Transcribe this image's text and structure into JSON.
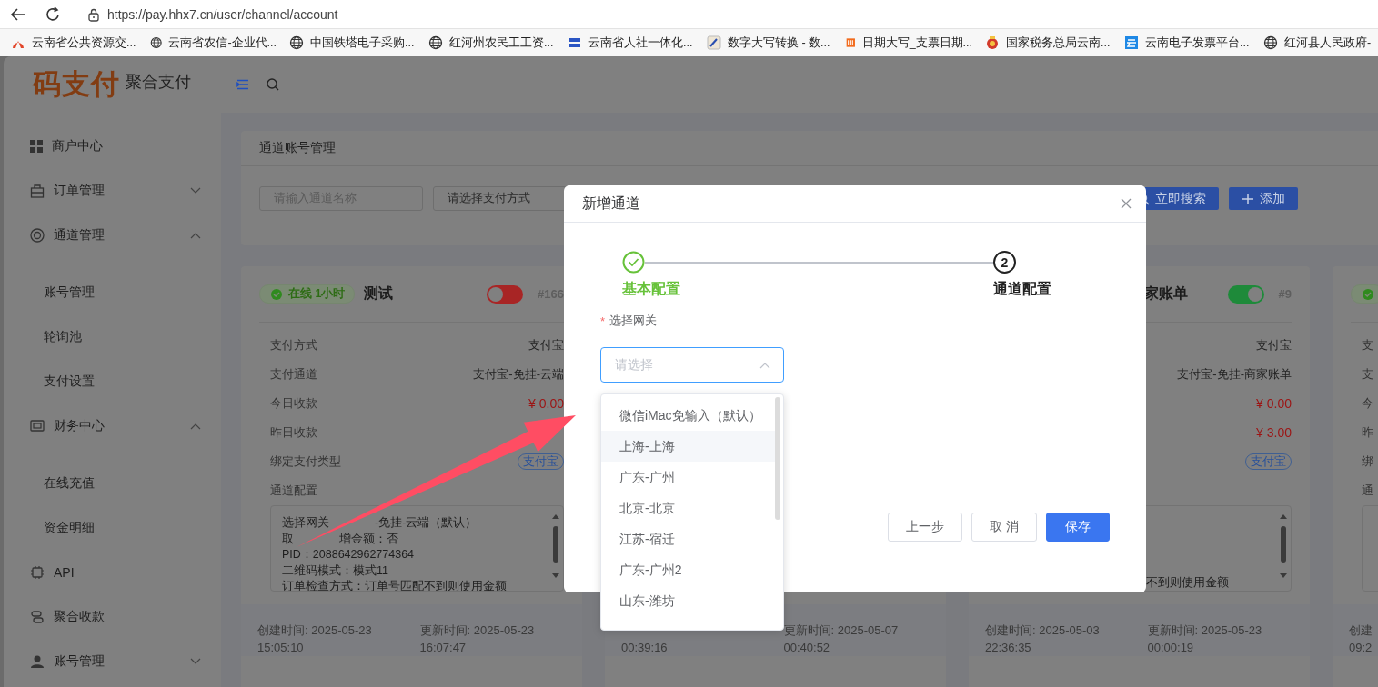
{
  "browser": {
    "url": "https://pay.hhx7.cn/user/channel/account",
    "bookmarks": [
      {
        "label": "云南省公共资源交...",
        "kind": "fire"
      },
      {
        "label": "云南省农信-企业代...",
        "kind": "globe"
      },
      {
        "label": "中国铁塔电子采购...",
        "kind": "globe"
      },
      {
        "label": "红河州农民工工资...",
        "kind": "globe"
      },
      {
        "label": "云南省人社一体化...",
        "kind": "badge"
      },
      {
        "label": "数字大写转换 - 数...",
        "kind": "pen"
      },
      {
        "label": "日期大写_支票日期...",
        "kind": "orange"
      },
      {
        "label": "国家税务总局云南...",
        "kind": "emblem"
      },
      {
        "label": "云南电子发票平台...",
        "kind": "cloud"
      },
      {
        "label": "红河县人民政府-",
        "kind": "globe"
      }
    ]
  },
  "header": {
    "logo": "码支付",
    "subtitle": "聚合支付"
  },
  "sidebar": {
    "items": [
      {
        "label": "商户中心",
        "kind": "grid"
      },
      {
        "label": "订单管理",
        "kind": "bag",
        "expanded": false
      },
      {
        "label": "通道管理",
        "kind": "ring",
        "expanded": true,
        "children": [
          {
            "label": "账号管理"
          },
          {
            "label": "轮询池"
          },
          {
            "label": "支付设置"
          }
        ]
      },
      {
        "label": "财务中心",
        "kind": "wallet",
        "expanded": true,
        "children": [
          {
            "label": "在线充值"
          },
          {
            "label": "资金明细"
          }
        ]
      },
      {
        "label": "API",
        "kind": "chip"
      },
      {
        "label": "聚合收款",
        "kind": "swap"
      },
      {
        "label": "账号管理",
        "kind": "user",
        "expanded": false
      }
    ]
  },
  "page": {
    "title": "通道账号管理",
    "name_placeholder": "请输入通道名称",
    "type_placeholder": "请选择支付方式",
    "buttons": [
      {
        "label": "立即搜索",
        "kind": "search"
      },
      {
        "label": "添加",
        "kind": "plus"
      }
    ]
  },
  "cards": [
    {
      "status": {
        "online": true,
        "text": "在线 1小时"
      },
      "title": "测试",
      "on": false,
      "id": "#166",
      "rows": [
        {
          "label": "支付方式",
          "value": "支付宝",
          "kind": "text"
        },
        {
          "label": "支付通道",
          "value": "支付宝-免挂-云端",
          "kind": "text"
        },
        {
          "label": "今日收款",
          "value": "¥ 0.00",
          "kind": "money"
        },
        {
          "label": "昨日收款"
        },
        {
          "label": "绑定支付类型",
          "value": "支付宝",
          "kind": "tag"
        }
      ],
      "config_label": "通道配置",
      "config_lines": [
        [
          "选择网关",
          "-免挂-云端（默认）"
        ],
        [
          "取",
          "增金额：否"
        ],
        [
          "PID：2088642962774364"
        ],
        [
          "二维码模式：模式11"
        ],
        [
          "订单检查方式：订单号匹配不到则使用金额"
        ]
      ],
      "created_lines": [
        "创建时间: 2025-05-23",
        "15:05:10"
      ],
      "updated_lines": [
        "更新时间: 2025-05-23",
        "16:07:47"
      ]
    },
    {
      "created_lines": [
        "00:39:16"
      ],
      "updated_lines": [
        "更新时间: 2025-05-07",
        "00:40:52"
      ]
    },
    {
      "title": "家账单",
      "on": true,
      "id": "#9",
      "rows": [
        {
          "value": "支付宝",
          "kind": "text"
        },
        {
          "value": "支付宝-免挂-商家账单",
          "kind": "text"
        },
        {
          "value": "¥ 0.00",
          "kind": "money"
        },
        {
          "value": "¥ 3.00",
          "kind": "money"
        },
        {
          "value": "支付宝",
          "kind": "tag"
        }
      ],
      "config_tail": "不到则使用金额",
      "created_lines": [
        "创建时间: 2025-05-03",
        "22:36:35"
      ],
      "updated_lines": [
        "更新时间: 2025-05-23",
        "00:00:19"
      ]
    },
    {
      "status": {
        "online": true
      },
      "rows": [
        {
          "label": "支"
        },
        {
          "label": "支"
        },
        {
          "label": "今"
        },
        {
          "label": "昨"
        },
        {
          "label": "绑"
        }
      ],
      "config_label": "通",
      "created_lines": [
        "创建",
        "09:2"
      ]
    }
  ],
  "dialog": {
    "title": "新增通道",
    "steps": [
      {
        "label": "基本配置",
        "done": true
      },
      {
        "label": "通道配置",
        "number": "2",
        "done": false
      }
    ],
    "field": {
      "required_mark": "*",
      "label": "选择网关",
      "placeholder": "请选择",
      "open": true
    },
    "options": [
      {
        "label": "微信iMac免输入（默认）",
        "hovered": false
      },
      {
        "label": "上海-上海",
        "hovered": true
      },
      {
        "label": "广东-广州",
        "hovered": false
      },
      {
        "label": "北京-北京",
        "hovered": false
      },
      {
        "label": "江苏-宿迁",
        "hovered": false
      },
      {
        "label": "广东-广州2",
        "hovered": false
      },
      {
        "label": "山东-潍坊",
        "hovered": false
      }
    ],
    "buttons": [
      {
        "label": "上一步",
        "kind": "default"
      },
      {
        "label": "取 消",
        "kind": "default"
      },
      {
        "label": "保存",
        "kind": "primary"
      }
    ]
  }
}
